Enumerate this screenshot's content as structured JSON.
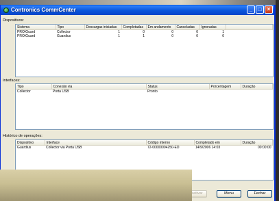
{
  "window": {
    "title": "Contronics CommCenter"
  },
  "dispositivos": {
    "label": "Dispositivos:",
    "columns": [
      "Sistema",
      "Tipo",
      "Descargas iniciadas",
      "Completadas",
      "Em andamento",
      "Canceladas",
      "Ignoradas"
    ],
    "rows": [
      [
        "PROIGuard",
        "Collector",
        "1",
        "0",
        "0",
        "0",
        "1"
      ],
      [
        "PROIGuard",
        "Guardius",
        "1",
        "1",
        "0",
        "0",
        "0"
      ]
    ]
  },
  "interfaces": {
    "label": "Interfaces:",
    "columns": [
      "Tipo",
      "Conexão via",
      "Status",
      "Porcentagem",
      "Duração"
    ],
    "rows": [
      [
        "Collector",
        "Porta USB",
        "Pronto",
        "",
        ""
      ]
    ]
  },
  "historico": {
    "label": "Histórico de operações:",
    "columns": [
      "Dispositivo",
      "Interface",
      "Código interno",
      "Completado em",
      "Duração"
    ],
    "rows": [
      [
        "Guardius",
        "Collector via Porta USB",
        "72-00000004250-ED",
        "14/9/2006 14:03",
        "00:00:00"
      ]
    ]
  },
  "buttons": {
    "desativar": "Desativar",
    "menu": "Menu",
    "fechar": "Fechar"
  }
}
